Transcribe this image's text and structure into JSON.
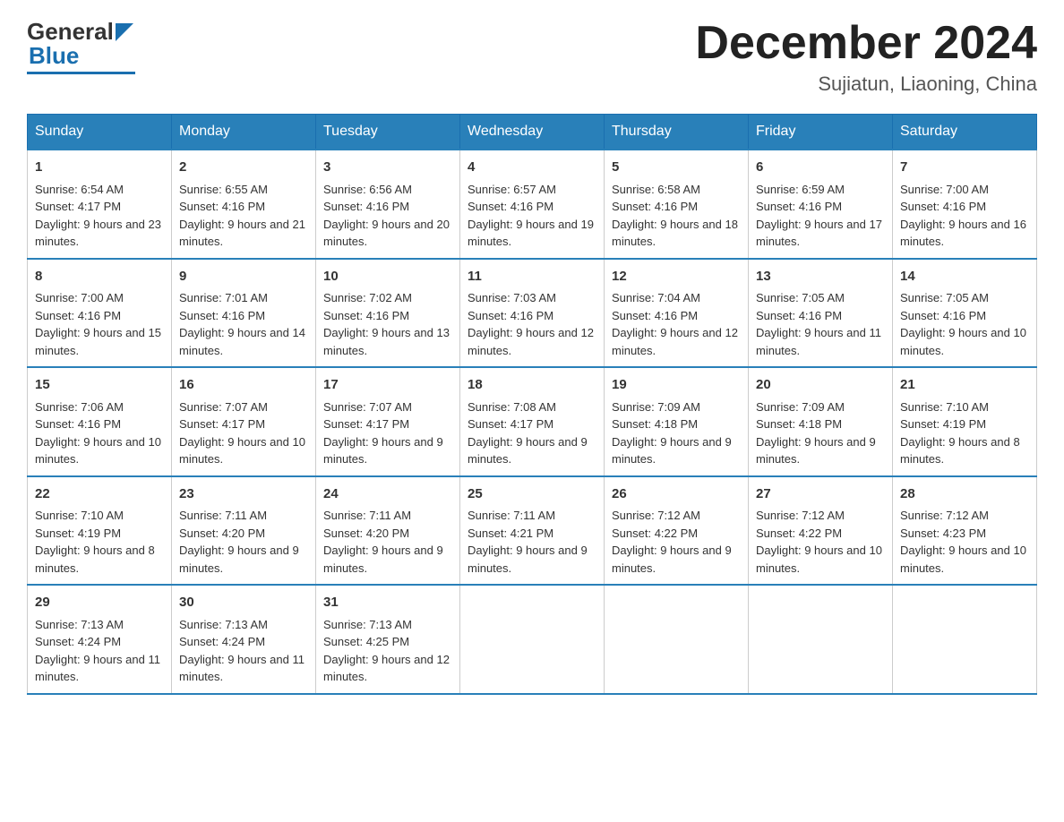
{
  "header": {
    "logo_general": "General",
    "logo_blue": "Blue",
    "month_title": "December 2024",
    "subtitle": "Sujiatun, Liaoning, China"
  },
  "days_of_week": [
    "Sunday",
    "Monday",
    "Tuesday",
    "Wednesday",
    "Thursday",
    "Friday",
    "Saturday"
  ],
  "weeks": [
    [
      {
        "day": "1",
        "sunrise": "6:54 AM",
        "sunset": "4:17 PM",
        "daylight": "9 hours and 23 minutes."
      },
      {
        "day": "2",
        "sunrise": "6:55 AM",
        "sunset": "4:16 PM",
        "daylight": "9 hours and 21 minutes."
      },
      {
        "day": "3",
        "sunrise": "6:56 AM",
        "sunset": "4:16 PM",
        "daylight": "9 hours and 20 minutes."
      },
      {
        "day": "4",
        "sunrise": "6:57 AM",
        "sunset": "4:16 PM",
        "daylight": "9 hours and 19 minutes."
      },
      {
        "day": "5",
        "sunrise": "6:58 AM",
        "sunset": "4:16 PM",
        "daylight": "9 hours and 18 minutes."
      },
      {
        "day": "6",
        "sunrise": "6:59 AM",
        "sunset": "4:16 PM",
        "daylight": "9 hours and 17 minutes."
      },
      {
        "day": "7",
        "sunrise": "7:00 AM",
        "sunset": "4:16 PM",
        "daylight": "9 hours and 16 minutes."
      }
    ],
    [
      {
        "day": "8",
        "sunrise": "7:00 AM",
        "sunset": "4:16 PM",
        "daylight": "9 hours and 15 minutes."
      },
      {
        "day": "9",
        "sunrise": "7:01 AM",
        "sunset": "4:16 PM",
        "daylight": "9 hours and 14 minutes."
      },
      {
        "day": "10",
        "sunrise": "7:02 AM",
        "sunset": "4:16 PM",
        "daylight": "9 hours and 13 minutes."
      },
      {
        "day": "11",
        "sunrise": "7:03 AM",
        "sunset": "4:16 PM",
        "daylight": "9 hours and 12 minutes."
      },
      {
        "day": "12",
        "sunrise": "7:04 AM",
        "sunset": "4:16 PM",
        "daylight": "9 hours and 12 minutes."
      },
      {
        "day": "13",
        "sunrise": "7:05 AM",
        "sunset": "4:16 PM",
        "daylight": "9 hours and 11 minutes."
      },
      {
        "day": "14",
        "sunrise": "7:05 AM",
        "sunset": "4:16 PM",
        "daylight": "9 hours and 10 minutes."
      }
    ],
    [
      {
        "day": "15",
        "sunrise": "7:06 AM",
        "sunset": "4:16 PM",
        "daylight": "9 hours and 10 minutes."
      },
      {
        "day": "16",
        "sunrise": "7:07 AM",
        "sunset": "4:17 PM",
        "daylight": "9 hours and 10 minutes."
      },
      {
        "day": "17",
        "sunrise": "7:07 AM",
        "sunset": "4:17 PM",
        "daylight": "9 hours and 9 minutes."
      },
      {
        "day": "18",
        "sunrise": "7:08 AM",
        "sunset": "4:17 PM",
        "daylight": "9 hours and 9 minutes."
      },
      {
        "day": "19",
        "sunrise": "7:09 AM",
        "sunset": "4:18 PM",
        "daylight": "9 hours and 9 minutes."
      },
      {
        "day": "20",
        "sunrise": "7:09 AM",
        "sunset": "4:18 PM",
        "daylight": "9 hours and 9 minutes."
      },
      {
        "day": "21",
        "sunrise": "7:10 AM",
        "sunset": "4:19 PM",
        "daylight": "9 hours and 8 minutes."
      }
    ],
    [
      {
        "day": "22",
        "sunrise": "7:10 AM",
        "sunset": "4:19 PM",
        "daylight": "9 hours and 8 minutes."
      },
      {
        "day": "23",
        "sunrise": "7:11 AM",
        "sunset": "4:20 PM",
        "daylight": "9 hours and 9 minutes."
      },
      {
        "day": "24",
        "sunrise": "7:11 AM",
        "sunset": "4:20 PM",
        "daylight": "9 hours and 9 minutes."
      },
      {
        "day": "25",
        "sunrise": "7:11 AM",
        "sunset": "4:21 PM",
        "daylight": "9 hours and 9 minutes."
      },
      {
        "day": "26",
        "sunrise": "7:12 AM",
        "sunset": "4:22 PM",
        "daylight": "9 hours and 9 minutes."
      },
      {
        "day": "27",
        "sunrise": "7:12 AM",
        "sunset": "4:22 PM",
        "daylight": "9 hours and 10 minutes."
      },
      {
        "day": "28",
        "sunrise": "7:12 AM",
        "sunset": "4:23 PM",
        "daylight": "9 hours and 10 minutes."
      }
    ],
    [
      {
        "day": "29",
        "sunrise": "7:13 AM",
        "sunset": "4:24 PM",
        "daylight": "9 hours and 11 minutes."
      },
      {
        "day": "30",
        "sunrise": "7:13 AM",
        "sunset": "4:24 PM",
        "daylight": "9 hours and 11 minutes."
      },
      {
        "day": "31",
        "sunrise": "7:13 AM",
        "sunset": "4:25 PM",
        "daylight": "9 hours and 12 minutes."
      },
      null,
      null,
      null,
      null
    ]
  ]
}
